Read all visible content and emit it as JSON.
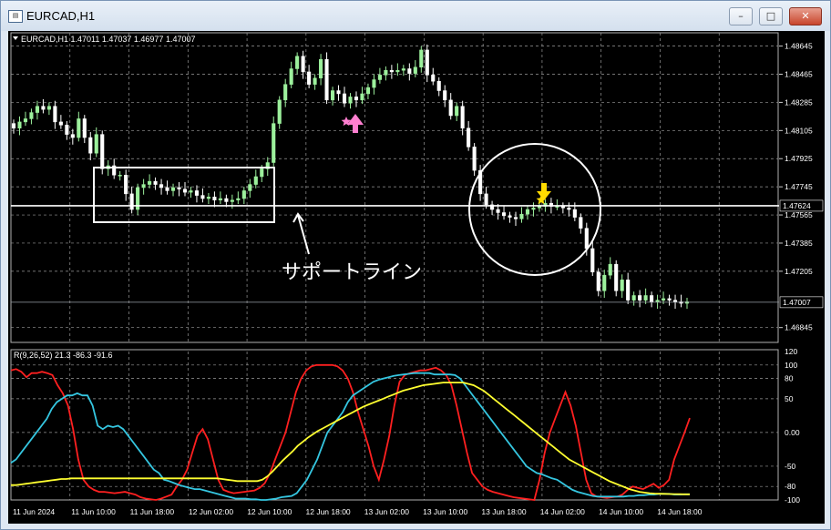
{
  "window": {
    "title": "EURCAD,H1",
    "minimize_glyph": "–",
    "maximize_glyph": "□",
    "close_glyph": "✕"
  },
  "chart_data": [
    {
      "type": "candlestick",
      "info_label": "EURCAD,H1  1.47011 1.47037 1.46977 1.47007",
      "ylim": [
        1.4675,
        1.4873
      ],
      "y_ticks": [
        "1.48645",
        "1.48465",
        "1.48285",
        "1.48105",
        "1.47925",
        "1.47745",
        "1.47565",
        "1.47385",
        "1.47205",
        "1.46845"
      ],
      "price_labels": [
        {
          "text": "1.47624",
          "value": 1.47624,
          "color": "#ffffff"
        },
        {
          "text": "1.47007",
          "value": 1.47007,
          "color": "#9aa0a8"
        }
      ],
      "x_ticks": [
        "11 Jun 2024",
        "11 Jun 10:00",
        "11 Jun 18:00",
        "12 Jun 02:00",
        "12 Jun 10:00",
        "12 Jun 18:00",
        "13 Jun 02:00",
        "13 Jun 10:00",
        "13 Jun 18:00",
        "14 Jun 02:00",
        "14 Jun 10:00",
        "14 Jun 18:00"
      ],
      "up_color": "#9cf09c",
      "down_color": "#ffffff",
      "close": [
        1.4812,
        1.4816,
        1.4818,
        1.4822,
        1.4826,
        1.4824,
        1.4826,
        1.4816,
        1.4814,
        1.4808,
        1.4806,
        1.4818,
        1.4806,
        1.4796,
        1.4808,
        1.4786,
        1.4788,
        1.4782,
        1.4782,
        1.477,
        1.476,
        1.4774,
        1.4776,
        1.4778,
        1.4776,
        1.4774,
        1.4772,
        1.4774,
        1.4773,
        1.4771,
        1.4772,
        1.4769,
        1.4767,
        1.4768,
        1.4766,
        1.4767,
        1.4765,
        1.4766,
        1.4767,
        1.4772,
        1.4776,
        1.4781,
        1.4786,
        1.479,
        1.4815,
        1.483,
        1.484,
        1.485,
        1.4858,
        1.4848,
        1.484,
        1.4844,
        1.4856,
        1.483,
        1.4836,
        1.4834,
        1.4828,
        1.4832,
        1.483,
        1.4834,
        1.4838,
        1.4843,
        1.4846,
        1.4849,
        1.4848,
        1.4849,
        1.485,
        1.4847,
        1.4851,
        1.4862,
        1.4846,
        1.4842,
        1.4836,
        1.483,
        1.482,
        1.4826,
        1.4812,
        1.48,
        1.4785,
        1.477,
        1.4763,
        1.476,
        1.4758,
        1.4756,
        1.4755,
        1.4754,
        1.4757,
        1.476,
        1.4761,
        1.4762,
        1.4764,
        1.4762,
        1.4762,
        1.4761,
        1.476,
        1.4755,
        1.4748,
        1.4735,
        1.472,
        1.4708,
        1.4718,
        1.4725,
        1.4708,
        1.4715,
        1.4702,
        1.4705,
        1.4702,
        1.4705,
        1.4701,
        1.4702,
        1.4703,
        1.4702,
        1.4701,
        1.47,
        1.4701
      ],
      "annotations": {
        "support_label": "サポートライン",
        "buy_marker_color": "#ff7fd0",
        "sell_marker_color": "#ffdc00"
      }
    },
    {
      "type": "line",
      "info_label": "R(9,26,52) 21.3 -86.3 -91.6",
      "ylim": [
        -100,
        120
      ],
      "y_ticks": [
        "120",
        "100",
        "80",
        "50",
        "0.00",
        "-50",
        "-80",
        "-100"
      ],
      "series": [
        {
          "color": "#ff2020",
          "values": [
            92,
            94,
            90,
            82,
            88,
            88,
            90,
            88,
            85,
            70,
            58,
            40,
            5,
            -40,
            -70,
            -80,
            -85,
            -88,
            -88,
            -89,
            -90,
            -89,
            -88,
            -90,
            -92,
            -96,
            -98,
            -99,
            -100,
            -98,
            -95,
            -92,
            -80,
            -70,
            -55,
            -30,
            -5,
            5,
            -10,
            -40,
            -70,
            -85,
            -88,
            -90,
            -89,
            -88,
            -87,
            -86,
            -82,
            -75,
            -60,
            -40,
            -20,
            0,
            30,
            60,
            80,
            92,
            98,
            100,
            100,
            100,
            100,
            98,
            92,
            80,
            60,
            30,
            5,
            -20,
            -50,
            -70,
            -40,
            -5,
            40,
            75,
            85,
            88,
            90,
            92,
            92,
            94,
            96,
            92,
            85,
            70,
            40,
            5,
            -30,
            -60,
            -70,
            -80,
            -85,
            -88,
            -90,
            -92,
            -94,
            -96,
            -97,
            -98,
            -99,
            -100,
            -70,
            -30,
            0,
            20,
            40,
            60,
            40,
            10,
            -30,
            -70,
            -90,
            -95,
            -96,
            -97,
            -96,
            -95,
            -92,
            -85,
            -80,
            -82,
            -84,
            -80,
            -76,
            -82,
            -78,
            -70,
            -40,
            -20,
            0,
            21.3
          ]
        },
        {
          "color": "#35c6e0",
          "values": [
            -45,
            -40,
            -30,
            -20,
            -10,
            0,
            10,
            20,
            35,
            45,
            50,
            55,
            55,
            58,
            55,
            55,
            40,
            10,
            5,
            10,
            8,
            10,
            5,
            -5,
            -15,
            -25,
            -35,
            -45,
            -55,
            -60,
            -70,
            -72,
            -75,
            -78,
            -80,
            -82,
            -84,
            -84,
            -86,
            -88,
            -90,
            -92,
            -94,
            -96,
            -98,
            -98,
            -98,
            -99,
            -99,
            -100,
            -100,
            -99,
            -98,
            -96,
            -95,
            -94,
            -90,
            -80,
            -70,
            -55,
            -40,
            -20,
            0,
            10,
            20,
            30,
            45,
            55,
            60,
            65,
            70,
            75,
            78,
            80,
            82,
            84,
            85,
            86,
            87,
            88,
            88,
            88,
            88,
            86,
            86,
            86,
            86,
            85,
            80,
            70,
            60,
            50,
            40,
            30,
            20,
            10,
            0,
            -10,
            -20,
            -30,
            -40,
            -50,
            -55,
            -60,
            -62,
            -65,
            -68,
            -70,
            -75,
            -80,
            -85,
            -88,
            -90,
            -92,
            -94,
            -95,
            -95,
            -95,
            -95,
            -95,
            -95,
            -94,
            -94,
            -93,
            -93,
            -92,
            -92,
            -91,
            -91,
            -91,
            -92,
            -92,
            -91.6,
            -91.6
          ]
        },
        {
          "color": "#ffff30",
          "values": [
            -78,
            -78,
            -77,
            -76,
            -75,
            -74,
            -73,
            -72,
            -71,
            -70,
            -69,
            -69,
            -68,
            -68,
            -68,
            -68,
            -68,
            -68,
            -68,
            -68,
            -68,
            -68,
            -68,
            -68,
            -68,
            -68,
            -68,
            -68,
            -68,
            -68,
            -68,
            -68,
            -68,
            -68,
            -68,
            -68,
            -68,
            -68,
            -68,
            -68,
            -68,
            -68,
            -69,
            -70,
            -71,
            -72,
            -72,
            -72,
            -72,
            -72,
            -70,
            -65,
            -58,
            -50,
            -42,
            -35,
            -28,
            -20,
            -14,
            -8,
            -3,
            2,
            6,
            10,
            14,
            18,
            22,
            26,
            30,
            34,
            38,
            41,
            44,
            47,
            50,
            53,
            56,
            59,
            62,
            64,
            66,
            68,
            70,
            71,
            72,
            73,
            74,
            74,
            74,
            74,
            74,
            72,
            70,
            66,
            62,
            56,
            50,
            44,
            38,
            32,
            26,
            20,
            14,
            8,
            2,
            -4,
            -10,
            -16,
            -22,
            -28,
            -34,
            -40,
            -44,
            -48,
            -52,
            -56,
            -60,
            -64,
            -68,
            -72,
            -75,
            -78,
            -81,
            -84,
            -86,
            -88,
            -89,
            -90,
            -90.5,
            -90.8,
            -91,
            -91.2,
            -91.4,
            -91.5,
            -91.6,
            -91.6
          ]
        }
      ]
    }
  ]
}
